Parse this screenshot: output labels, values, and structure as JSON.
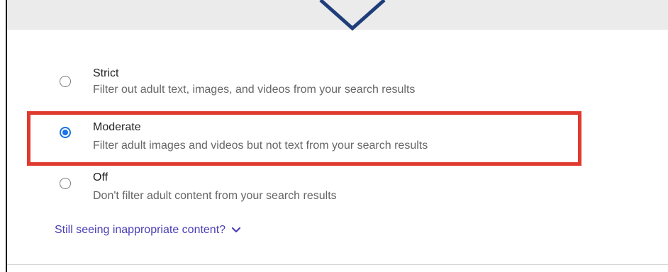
{
  "safe_search": {
    "options": [
      {
        "label": "Strict",
        "description": "Filter out adult text, images, and videos from your search results",
        "selected": false
      },
      {
        "label": "Moderate",
        "description": "Filter adult images and videos but not text from your search results",
        "selected": true
      },
      {
        "label": "Off",
        "description": "Don't filter adult content from your search results",
        "selected": false
      }
    ],
    "help_link": "Still seeing inappropriate content?"
  },
  "colors": {
    "highlight": "#e03a2e",
    "radio_selected": "#1a73e8",
    "link": "#4a3fb5",
    "chevron": "#1f3d7a"
  },
  "icons": {
    "top_chevron": "chevron-down-icon",
    "link_chevron": "chevron-down-icon"
  }
}
